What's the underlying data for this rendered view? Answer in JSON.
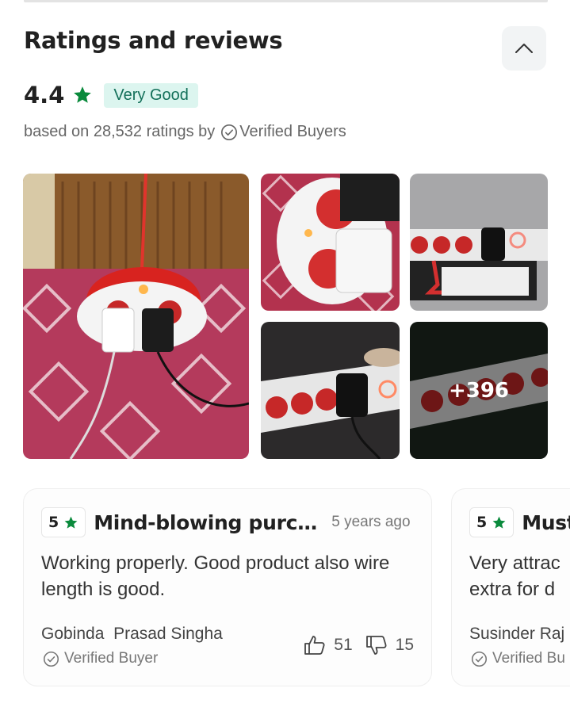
{
  "section": {
    "title": "Ratings and reviews",
    "rating": "4.4",
    "rating_label": "Very Good",
    "based_on_prefix": "based on 28,532 ratings by",
    "verified_text": "Verified Buyers"
  },
  "photos": {
    "more_count": "+396"
  },
  "colors": {
    "star_green": "#0a8a3c",
    "badge_bg": "#dcf5ef",
    "badge_text": "#14705a"
  },
  "reviews": [
    {
      "stars": "5",
      "title": "Mind-blowing purchase",
      "time": "5 years ago",
      "body": "Working properly. Good product also wire length is good.",
      "author": "Gobinda  Prasad Singha",
      "verified": "Verified Buyer",
      "likes": "51",
      "dislikes": "15"
    },
    {
      "stars": "5",
      "title": "Must",
      "time": "",
      "body": "Very attrac extra for d",
      "author": "Susinder Raj",
      "verified": "Verified Bu"
    }
  ]
}
